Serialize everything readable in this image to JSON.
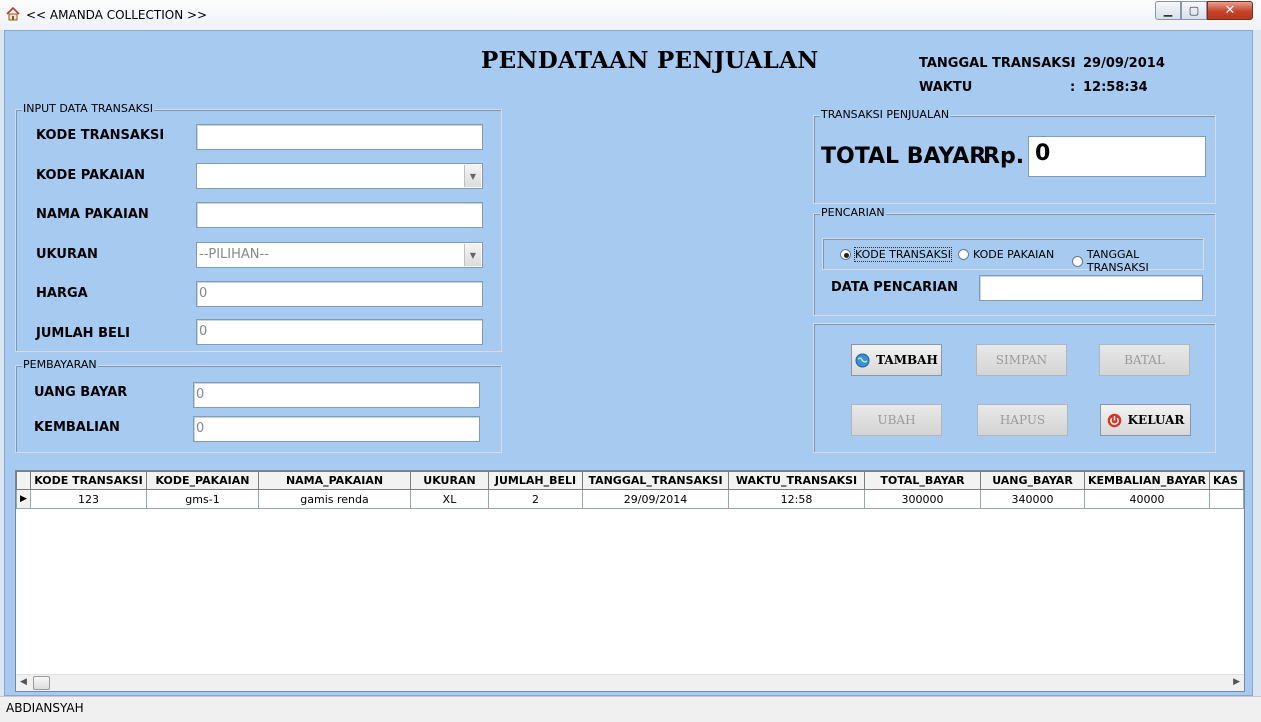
{
  "window": {
    "title": "<< AMANDA COLLECTION >>"
  },
  "heading": "PENDATAAN PENJUALAN",
  "info": {
    "tanggal_label": "TANGGAL TRANSAKSI",
    "tanggal_colon": ":",
    "tanggal_value": "29/09/2014",
    "waktu_label": "WAKTU",
    "waktu_colon": ":",
    "waktu_value": "12:58:34"
  },
  "input_group": {
    "legend": "INPUT DATA TRANSAKSI",
    "kode_transaksi": {
      "label": "KODE TRANSAKSI",
      "value": ""
    },
    "kode_pakaian": {
      "label": "KODE PAKAIAN",
      "value": ""
    },
    "nama_pakaian": {
      "label": "NAMA PAKAIAN",
      "value": ""
    },
    "ukuran": {
      "label": "UKURAN",
      "value": "--PILIHAN--"
    },
    "harga": {
      "label": "HARGA",
      "value": "0"
    },
    "jumlah_beli": {
      "label": "JUMLAH BELI",
      "value": "0"
    }
  },
  "payment_group": {
    "legend": "PEMBAYARAN",
    "uang_bayar": {
      "label": "UANG BAYAR",
      "value": "0"
    },
    "kembalian": {
      "label": "KEMBALIAN",
      "value": "0"
    }
  },
  "total_group": {
    "legend": "TRANSAKSI PENJUALAN",
    "label": "TOTAL BAYAR",
    "currency": "Rp.",
    "value": "0"
  },
  "search_group": {
    "legend": "PENCARIAN",
    "options": [
      "KODE TRANSAKSI",
      "KODE PAKAIAN",
      "TANGGAL TRANSAKSI"
    ],
    "selected": 0,
    "data_label": "DATA PENCARIAN",
    "data_value": ""
  },
  "buttons": {
    "tambah": "TAMBAH",
    "simpan": "SIMPAN",
    "batal": "BATAL",
    "ubah": "UBAH",
    "hapus": "HAPUS",
    "keluar": "KELUAR"
  },
  "table": {
    "columns": [
      "KODE TRANSAKSI",
      "KODE_PAKAIAN",
      "NAMA_PAKAIAN",
      "UKURAN",
      "JUMLAH_BELI",
      "TANGGAL_TRANSAKSI",
      "WAKTU_TRANSAKSI",
      "TOTAL_BAYAR",
      "UANG_BAYAR",
      "KEMBALIAN_BAYAR",
      "KAS"
    ],
    "rows": [
      [
        "123",
        "gms-1",
        "gamis renda",
        "XL",
        "2",
        "29/09/2014",
        "12:58",
        "300000",
        "340000",
        "40000",
        ""
      ]
    ]
  },
  "status": {
    "text": "ABDIANSYAH"
  },
  "colors": {
    "client_bg": "#a6caf0",
    "keluar_icon": "#d9342b",
    "tambah_icon": "#3a8fd8"
  }
}
